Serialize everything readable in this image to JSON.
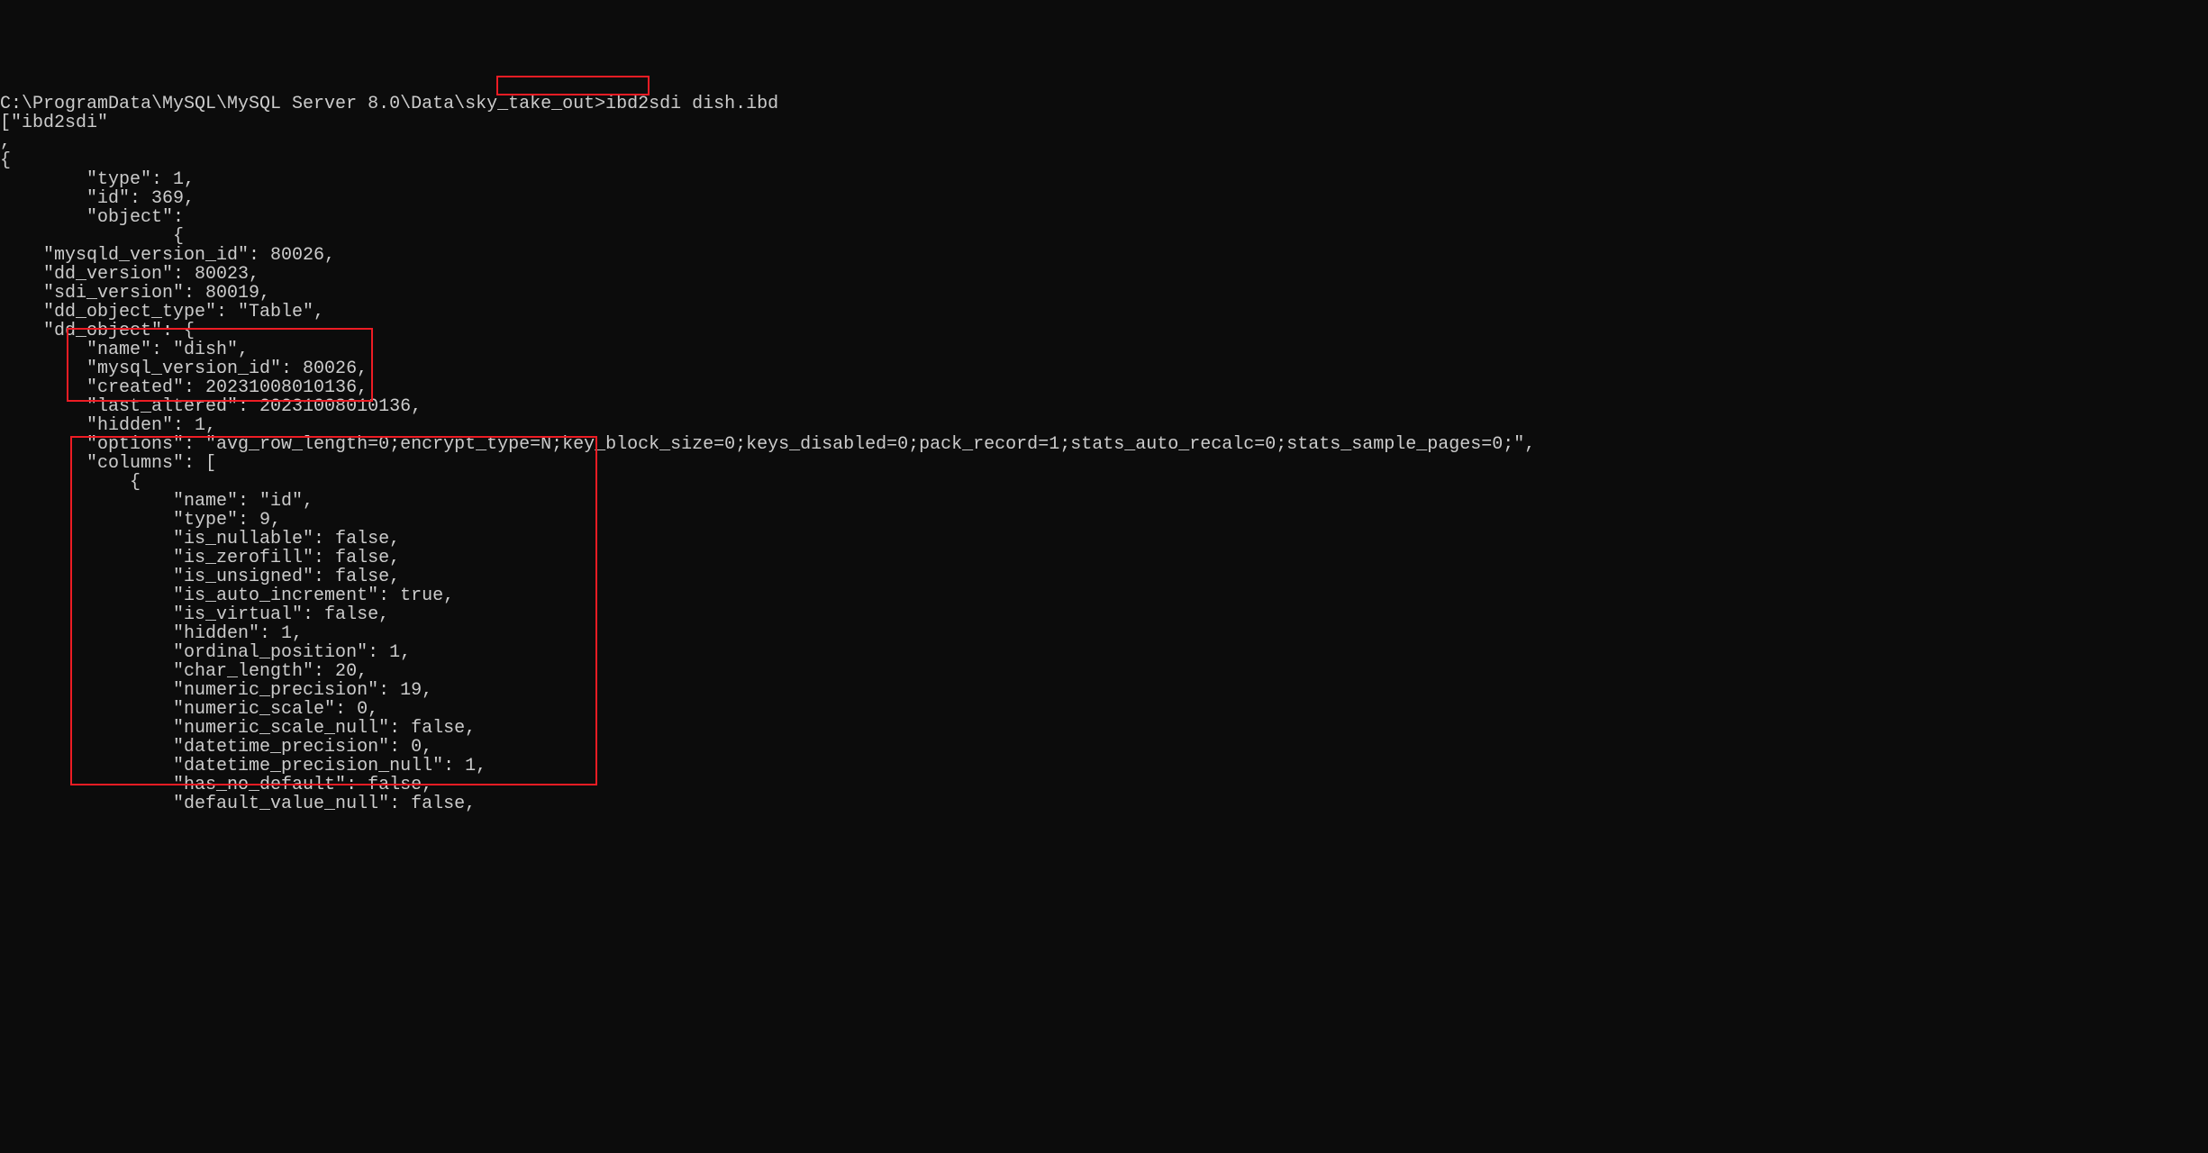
{
  "prompt_path": "C:\\ProgramData\\MySQL\\MySQL Server 8.0\\Data\\sky_take_out>",
  "command": "ibd2sdi dish.ibd",
  "line_header": "[\"ibd2sdi\"",
  "line_comma": ",",
  "line_open": "{",
  "l_type": "        \"type\": 1,",
  "l_id": "        \"id\": 369,",
  "l_object": "        \"object\":",
  "l_brace_obj": "                {",
  "l_mysqld_ver": "    \"mysqld_version_id\": 80026,",
  "l_dd_ver": "    \"dd_version\": 80023,",
  "l_sdi_ver": "    \"sdi_version\": 80019,",
  "l_dd_obj_type": "    \"dd_object_type\": \"Table\",",
  "l_dd_obj": "    \"dd_object\": {",
  "l_name": "        \"name\": \"dish\",",
  "l_mysql_ver": "        \"mysql_version_id\": 80026,",
  "l_created": "        \"created\": 20231008010136,",
  "l_last_altered": "        \"last_altered\": 20231008010136,",
  "l_hidden": "        \"hidden\": 1,",
  "l_options": "        \"options\": \"avg_row_length=0;encrypt_type=N;key_block_size=0;keys_disabled=0;pack_record=1;stats_auto_recalc=0;stats_sample_pages=0;\",",
  "l_columns": "        \"columns\": [",
  "l_col_open": "            {",
  "l_col_name": "                \"name\": \"id\",",
  "l_col_type": "                \"type\": 9,",
  "l_col_nullable": "                \"is_nullable\": false,",
  "l_col_zerofill": "                \"is_zerofill\": false,",
  "l_col_unsigned": "                \"is_unsigned\": false,",
  "l_col_autoinc": "                \"is_auto_increment\": true,",
  "l_col_virtual": "                \"is_virtual\": false,",
  "l_col_hidden": "                \"hidden\": 1,",
  "l_col_ordinal": "                \"ordinal_position\": 1,",
  "l_col_charlen": "                \"char_length\": 20,",
  "l_col_numprec": "                \"numeric_precision\": 19,",
  "l_col_numscale": "                \"numeric_scale\": 0,",
  "l_col_numscalenull": "                \"numeric_scale_null\": false,",
  "l_col_dtprec": "                \"datetime_precision\": 0,",
  "l_col_dtprecnull": "                \"datetime_precision_null\": 1,",
  "l_col_hasnodef": "                \"has_no_default\": false,",
  "l_col_defvalnull": "                \"default_value_null\": false,"
}
